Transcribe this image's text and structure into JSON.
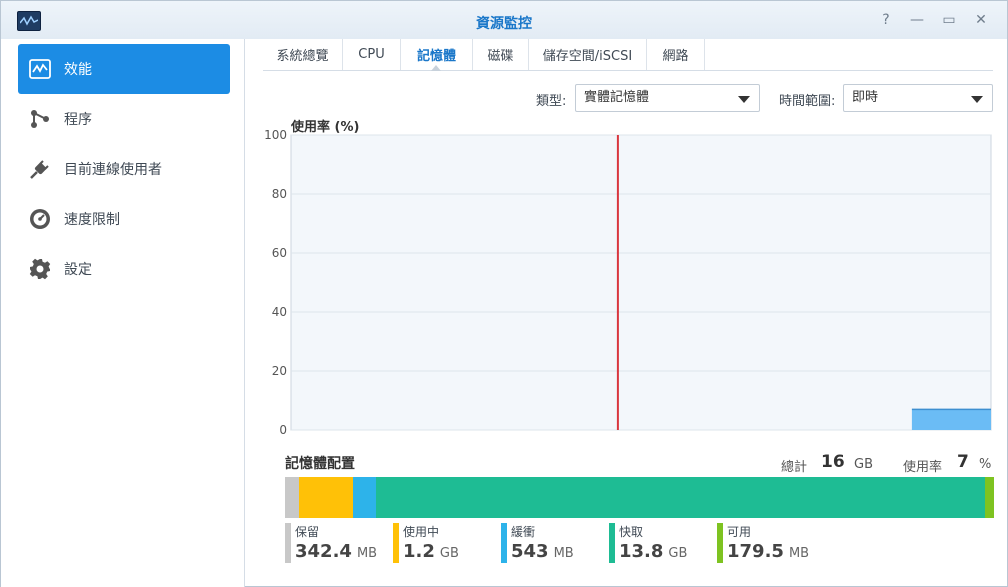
{
  "window": {
    "title": "資源監控",
    "controls": {
      "help": "?",
      "minimize": "—",
      "maximize": "▭",
      "close": "✕"
    }
  },
  "sidebar": {
    "items": [
      {
        "label": "效能",
        "icon": "performance-chart-icon",
        "active": true
      },
      {
        "label": "程序",
        "icon": "process-icon",
        "active": false
      },
      {
        "label": "目前連線使用者",
        "icon": "plug-icon",
        "active": false
      },
      {
        "label": "速度限制",
        "icon": "speed-gauge-icon",
        "active": false
      },
      {
        "label": "設定",
        "icon": "gear-icon",
        "active": false
      }
    ]
  },
  "tabs": [
    {
      "label": "系統總覽",
      "active": false
    },
    {
      "label": "CPU",
      "active": false
    },
    {
      "label": "記憶體",
      "active": true
    },
    {
      "label": "磁碟",
      "active": false
    },
    {
      "label": "儲存空間/iSCSI",
      "active": false
    },
    {
      "label": "網路",
      "active": false
    }
  ],
  "filters": {
    "type_label": "類型:",
    "type_value": "實體記憶體",
    "range_label": "時間範圍:",
    "range_value": "即時"
  },
  "chart_data": {
    "type": "area",
    "title": "使用率 (%)",
    "ylim": [
      0,
      100
    ],
    "yticks": [
      "100",
      "80",
      "60",
      "40",
      "20",
      "0"
    ],
    "grid": true,
    "series": [
      {
        "values": [
          7,
          7,
          7,
          7,
          7,
          7
        ],
        "color": "#6bbcf5",
        "coverage": 0.113
      }
    ],
    "marker_color": "#d9363e"
  },
  "memory": {
    "section_title": "記憶體配置",
    "total_label": "總計",
    "total_value": "16",
    "total_unit": "GB",
    "usage_label": "使用率",
    "usage_value": "7",
    "usage_unit": "%",
    "segments": [
      {
        "name": "保留",
        "value": "342.4",
        "unit": "MB",
        "color": "#c8c8c8",
        "share": 0.02
      },
      {
        "name": "使用中",
        "value": "1.2",
        "unit": "GB",
        "color": "#ffc107",
        "share": 0.076
      },
      {
        "name": "緩衝",
        "value": "543",
        "unit": "MB",
        "color": "#2db3ea",
        "share": 0.032
      },
      {
        "name": "快取",
        "value": "13.8",
        "unit": "GB",
        "color": "#1ebc94",
        "share": 0.86
      },
      {
        "name": "可用",
        "value": "179.5",
        "unit": "MB",
        "color": "#7ec321",
        "share": 0.012
      }
    ]
  }
}
